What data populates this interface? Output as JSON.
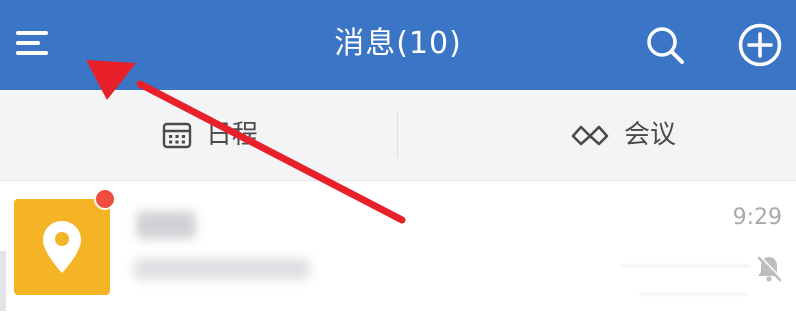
{
  "header": {
    "title": "消息(10)",
    "background_color": "#3b76c6",
    "menu_icon": "menu-icon",
    "search_icon": "search-icon",
    "add_icon": "add-circle-icon"
  },
  "tabs": [
    {
      "label": "日程",
      "icon": "calendar-icon"
    },
    {
      "label": "会议",
      "icon": "meeting-icon"
    }
  ],
  "messages": [
    {
      "time": "9:29",
      "avatar_icon": "location-pin-icon",
      "avatar_color": "#f4b426",
      "unread_dot_color": "#f04d3f",
      "muted": true,
      "mute_icon": "bell-muted-icon"
    }
  ],
  "annotation": {
    "color": "#e8202a",
    "points_to": "menu-button"
  }
}
